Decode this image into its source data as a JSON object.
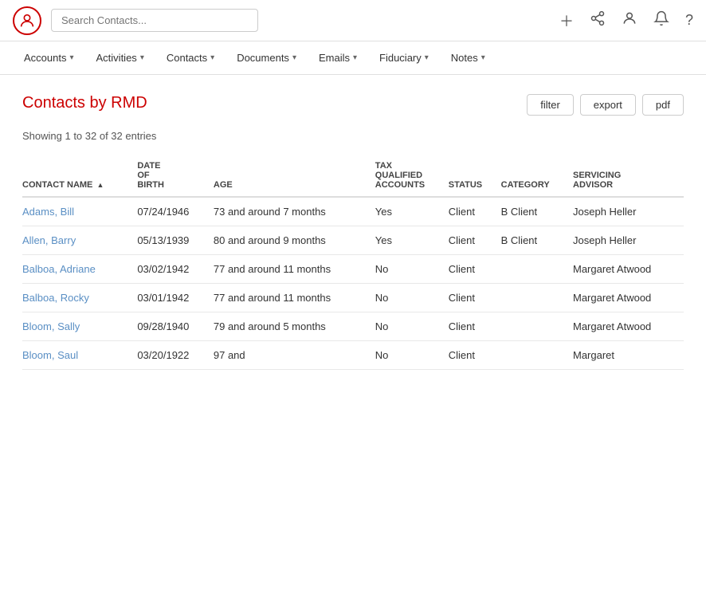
{
  "topbar": {
    "search_placeholder": "Search Contacts...",
    "icons": [
      "plus-icon",
      "share-icon",
      "person-icon",
      "bell-icon",
      "help-icon"
    ]
  },
  "nav": {
    "items": [
      {
        "label": "Accounts",
        "id": "accounts"
      },
      {
        "label": "Activities",
        "id": "activities"
      },
      {
        "label": "Contacts",
        "id": "contacts"
      },
      {
        "label": "Documents",
        "id": "documents"
      },
      {
        "label": "Emails",
        "id": "emails"
      },
      {
        "label": "Fiduciary",
        "id": "fiduciary"
      },
      {
        "label": "Notes",
        "id": "notes"
      }
    ]
  },
  "page": {
    "title": "Contacts by RMD",
    "entries_info": "Showing 1 to 32 of 32 entries",
    "buttons": {
      "filter": "filter",
      "export": "export",
      "pdf": "pdf"
    }
  },
  "table": {
    "columns": [
      {
        "key": "name",
        "label": "CONTACT NAME",
        "sortable": true
      },
      {
        "key": "dob",
        "label": "DATE OF BIRTH",
        "sortable": false
      },
      {
        "key": "age",
        "label": "AGE",
        "sortable": false
      },
      {
        "key": "tqa",
        "label": "TAX QUALIFIED ACCOUNTS",
        "sortable": false
      },
      {
        "key": "status",
        "label": "STATUS",
        "sortable": false
      },
      {
        "key": "category",
        "label": "CATEGORY",
        "sortable": false
      },
      {
        "key": "advisor",
        "label": "SERVICING ADVISOR",
        "sortable": false
      }
    ],
    "rows": [
      {
        "name": "Adams, Bill",
        "dob": "07/24/1946",
        "age": "73 and around 7 months",
        "tqa": "Yes",
        "status": "Client",
        "category": "B Client",
        "advisor": "Joseph Heller"
      },
      {
        "name": "Allen, Barry",
        "dob": "05/13/1939",
        "age": "80 and around 9 months",
        "tqa": "Yes",
        "status": "Client",
        "category": "B Client",
        "advisor": "Joseph Heller"
      },
      {
        "name": "Balboa, Adriane",
        "dob": "03/02/1942",
        "age": "77 and around 11 months",
        "tqa": "No",
        "status": "Client",
        "category": "",
        "advisor": "Margaret Atwood"
      },
      {
        "name": "Balboa, Rocky",
        "dob": "03/01/1942",
        "age": "77 and around 11 months",
        "tqa": "No",
        "status": "Client",
        "category": "",
        "advisor": "Margaret Atwood"
      },
      {
        "name": "Bloom, Sally",
        "dob": "09/28/1940",
        "age": "79 and around 5 months",
        "tqa": "No",
        "status": "Client",
        "category": "",
        "advisor": "Margaret Atwood"
      },
      {
        "name": "Bloom, Saul",
        "dob": "03/20/1922",
        "age": "97 and",
        "tqa": "No",
        "status": "Client",
        "category": "",
        "advisor": "Margaret"
      }
    ]
  }
}
